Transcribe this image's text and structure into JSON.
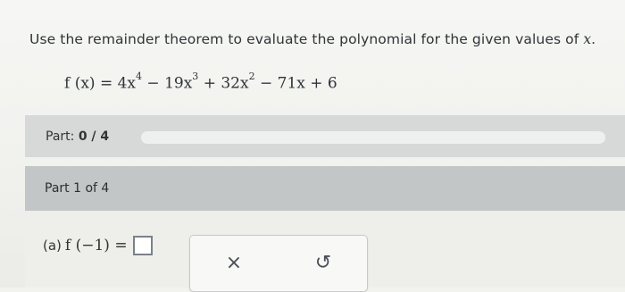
{
  "question": {
    "text_before": "Use the remainder theorem to evaluate the polynomial for the given values of ",
    "variable": "x",
    "text_after": "."
  },
  "formula": {
    "lhs": "f (x) = 4x",
    "exp1": "4",
    "term2": " − 19x",
    "exp2": "3",
    "term3": " + 32x",
    "exp3": "2",
    "tail": " − 71x + 6"
  },
  "progress": {
    "label": "Part:",
    "value": "0 / 4",
    "fraction": 0
  },
  "part_header": {
    "label": "Part 1 of 4"
  },
  "answer": {
    "prefix": "(a)",
    "expression": "f (−1) ="
  },
  "tools": {
    "clear_icon": "×",
    "undo_icon": "↺"
  },
  "colors": {
    "page": "#f2f2ef",
    "status_bar": "#d6d9d8",
    "part_header": "#c2c6c7",
    "answer_area": "#eeeeeb",
    "text": "#2f3437"
  }
}
